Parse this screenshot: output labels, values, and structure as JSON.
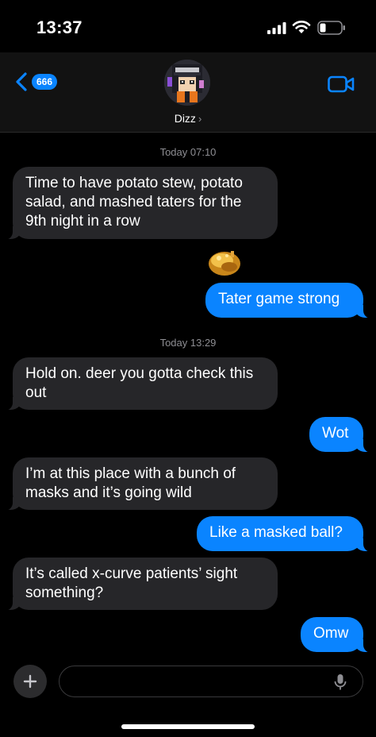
{
  "status_bar": {
    "time": "13:37"
  },
  "header": {
    "back_badge": "666",
    "contact_name": "Dizz",
    "chevron": "›"
  },
  "timestamps": [
    "Today 07:10",
    "Today 13:29"
  ],
  "messages": [
    {
      "dir": "in",
      "text": "Time to have potato stew, potato salad, and mashed taters for the 9th night in a row"
    },
    {
      "dir": "out",
      "text": "Tater game strong"
    },
    {
      "dir": "in",
      "text": "Hold on. deer you gotta check this out"
    },
    {
      "dir": "out",
      "text": "Wot"
    },
    {
      "dir": "in",
      "text": "I’m at this place with a bunch of masks and it’s going wild"
    },
    {
      "dir": "out",
      "text": "Like a masked ball?"
    },
    {
      "dir": "in",
      "text": "It’s called x-curve patients’ sight something?"
    },
    {
      "dir": "out",
      "text": "Omw"
    }
  ],
  "composer": {
    "placeholder": ""
  },
  "icons": {
    "back": "chevron-left-icon",
    "video": "video-camera-icon",
    "plus": "plus-icon",
    "mic": "microphone-icon",
    "sticker": "roast-potato-sticker"
  },
  "colors": {
    "accent": "#0a84ff",
    "incoming_bubble": "#262629",
    "background": "#000000"
  }
}
